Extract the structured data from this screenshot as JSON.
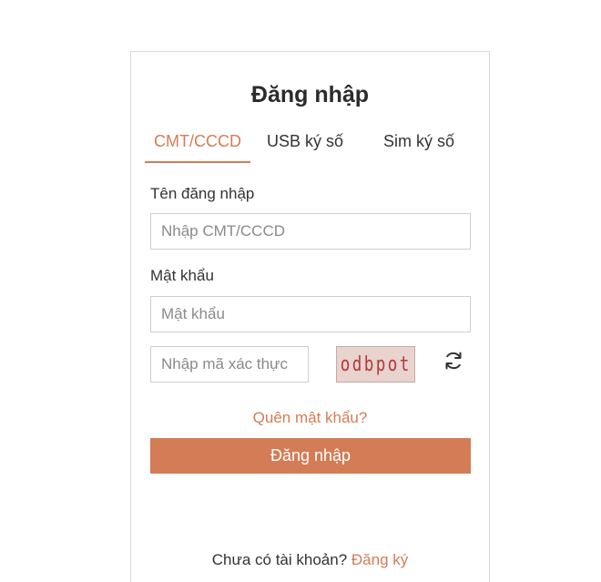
{
  "login": {
    "title": "Đăng nhập",
    "tabs": [
      {
        "label": "CMT/CCCD",
        "active": true
      },
      {
        "label": "USB ký số",
        "active": false
      },
      {
        "label": "Sim ký số",
        "active": false
      }
    ],
    "username": {
      "label": "Tên đăng nhập",
      "placeholder": "Nhập CMT/CCCD",
      "value": ""
    },
    "password": {
      "label": "Mật khẩu",
      "placeholder": "Mật khẩu",
      "value": ""
    },
    "captcha": {
      "placeholder": "Nhập mã xác thực",
      "value": "",
      "image_text": "odbpot",
      "refresh_icon": "refresh-icon"
    },
    "forgot_password": "Quên mật khẩu?",
    "submit_label": "Đăng nhập",
    "no_account_text": "Chưa có tài khoản?",
    "register_link": "Đăng ký"
  },
  "colors": {
    "accent": "#d37c55",
    "border": "#d9d9d9",
    "text": "#333333"
  }
}
